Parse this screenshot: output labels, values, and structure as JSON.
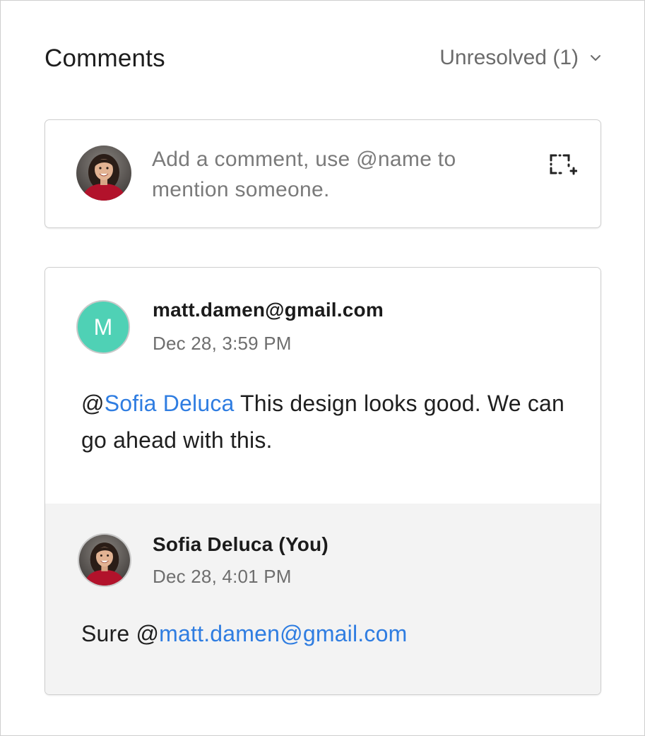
{
  "header": {
    "title": "Comments",
    "filter_label": "Unresolved (1)"
  },
  "composer": {
    "placeholder": "Add a comment, use @name to mention someone."
  },
  "comment": {
    "avatar_letter": "M",
    "author": "matt.damen@gmail.com",
    "timestamp": "Dec 28, 3:59 PM",
    "mention_prefix": "@",
    "mention_name": "Sofia Deluca",
    "body": " This design looks good. We can go ahead with this."
  },
  "reply": {
    "author": "Sofia Deluca (You)",
    "timestamp": "Dec 28, 4:01 PM",
    "body_prefix": "Sure @",
    "mention": "matt.damen@gmail.com"
  },
  "colors": {
    "accent_link": "#2f7de1",
    "avatar_bg": "#4fd1b5",
    "reply_bg": "#f3f3f3"
  },
  "icons": {
    "filter_chevron": "chevron-down-icon",
    "attach": "screenshot-add-icon"
  }
}
